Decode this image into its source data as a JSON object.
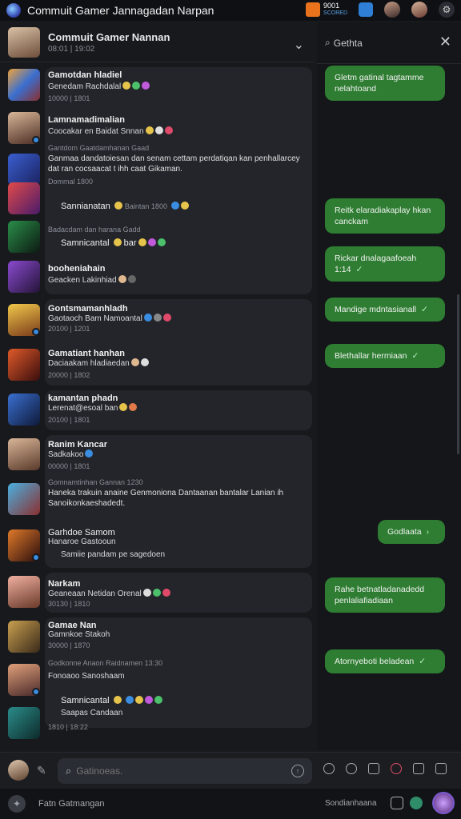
{
  "app": {
    "title": "Commuit Gamer Jannagadan Narpan"
  },
  "topbar": {
    "coin_value": "9001",
    "coin_sub": "SCORED"
  },
  "list_header": {
    "title": "Commuit Gamer Nannan",
    "sub": "08:01 | 19:02"
  },
  "chats": [
    {
      "name": "Gamotdan hladiel",
      "msg": "Genedam Rachdalal",
      "meta": "10000 | 1801"
    },
    {
      "name": "Lamnamadimalian",
      "msg": "Coocakar en Baidat Snnan"
    },
    {
      "name": "",
      "meta": "Gantdom Gaatdamhanan Gaad",
      "long": "Ganmaa dandatoiesan dan senam cettam perdatiqan kan penhallarcey dat ran cocsaacat t ihh caat Gikaman.",
      "sub": "Dommal 1800"
    },
    {
      "name": "Sannianatan",
      "meta": "Baintan 1800"
    },
    {
      "name": "",
      "meta": "Badacdam dan harana Gadd"
    },
    {
      "name": "Samnicantal",
      "msg": "bar"
    },
    {
      "name": "booheniahain",
      "msg": "Geacken Lakinhiad"
    },
    {
      "name": "Gontsmamanhladh",
      "msg": "Gaotaoch Bam Namoantal",
      "meta": "20100 | 1201"
    },
    {
      "name": "Gamatiant hanhan",
      "msg": "Daciaakam hladiaedan",
      "meta": "20000 | 1802"
    },
    {
      "name": "kamantan phadn",
      "msg": "Lerenat@esoal ban",
      "meta": "20100 | 1801"
    },
    {
      "name": "Ranim Kancar",
      "msg": "Sadkakoo",
      "meta": "00000 | 1801"
    },
    {
      "name": "",
      "meta": "Gomnamtinhan Gannan 1230",
      "long": "Haneka trakuin anaine Genmoniona Dantaanan bantalar Lanian ih Sanoikonkaeshadedt."
    },
    {
      "name": "Garhdoe Samom",
      "msg": "Hanaroe Gastooun",
      "sub": "Samiie pandam pe sagedoen"
    },
    {
      "name": "Narkam",
      "msg": "Geaneaan Netidan Orenal",
      "meta": "30130 | 1810"
    },
    {
      "name": "Gamae Nan",
      "msg": "Gamnkoe Stakoh",
      "meta": "30000 | 1870"
    },
    {
      "name": "",
      "meta": "Godkonne Anaon  Raidnamen 13:30",
      "msg": "Fonoaoo Sanoshaam"
    },
    {
      "name": "Samnicantal",
      "msg": "Saapas Candaan",
      "meta": "1810 | 18:22"
    }
  ],
  "right_panel": {
    "title": "Gethta",
    "bubbles": [
      "Gletm gatinal tagtamme nelahtoand",
      "Reitk elaradiakaplay hkan canckam",
      "Rickar dnalagaafoeah 1:14",
      "Mandige mdntasianall",
      "Blethallar hermiaan",
      "Godlaata",
      "Rahe betnatladanadedd penlaliafiadiaan",
      "Atornyeboti beladean"
    ]
  },
  "composer": {
    "placeholder": "Gatinoeas."
  },
  "statusbar": {
    "left": "Fatn  Gatmangan",
    "right": "Sondianhaana"
  }
}
